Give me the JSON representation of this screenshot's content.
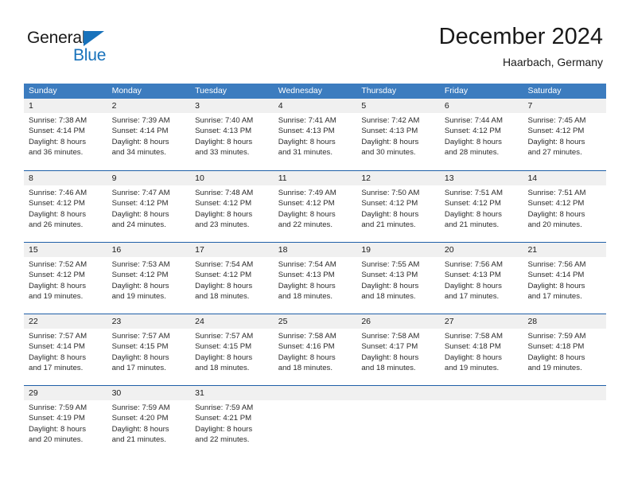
{
  "brand": {
    "name_part1": "General",
    "name_part2": "Blue",
    "logo_icon": "triangle-icon",
    "color_blue": "#1872bb"
  },
  "header": {
    "title": "December 2024",
    "subtitle": "Haarbach, Germany"
  },
  "colors": {
    "header_blue": "#3c7cbf",
    "row_separator_blue": "#1f5fa8",
    "row_band_gray": "#f0f0f0"
  },
  "weekdays": [
    "Sunday",
    "Monday",
    "Tuesday",
    "Wednesday",
    "Thursday",
    "Friday",
    "Saturday"
  ],
  "weeks": [
    [
      {
        "day": "1",
        "sunrise": "Sunrise: 7:38 AM",
        "sunset": "Sunset: 4:14 PM",
        "daylight1": "Daylight: 8 hours",
        "daylight2": "and 36 minutes."
      },
      {
        "day": "2",
        "sunrise": "Sunrise: 7:39 AM",
        "sunset": "Sunset: 4:14 PM",
        "daylight1": "Daylight: 8 hours",
        "daylight2": "and 34 minutes."
      },
      {
        "day": "3",
        "sunrise": "Sunrise: 7:40 AM",
        "sunset": "Sunset: 4:13 PM",
        "daylight1": "Daylight: 8 hours",
        "daylight2": "and 33 minutes."
      },
      {
        "day": "4",
        "sunrise": "Sunrise: 7:41 AM",
        "sunset": "Sunset: 4:13 PM",
        "daylight1": "Daylight: 8 hours",
        "daylight2": "and 31 minutes."
      },
      {
        "day": "5",
        "sunrise": "Sunrise: 7:42 AM",
        "sunset": "Sunset: 4:13 PM",
        "daylight1": "Daylight: 8 hours",
        "daylight2": "and 30 minutes."
      },
      {
        "day": "6",
        "sunrise": "Sunrise: 7:44 AM",
        "sunset": "Sunset: 4:12 PM",
        "daylight1": "Daylight: 8 hours",
        "daylight2": "and 28 minutes."
      },
      {
        "day": "7",
        "sunrise": "Sunrise: 7:45 AM",
        "sunset": "Sunset: 4:12 PM",
        "daylight1": "Daylight: 8 hours",
        "daylight2": "and 27 minutes."
      }
    ],
    [
      {
        "day": "8",
        "sunrise": "Sunrise: 7:46 AM",
        "sunset": "Sunset: 4:12 PM",
        "daylight1": "Daylight: 8 hours",
        "daylight2": "and 26 minutes."
      },
      {
        "day": "9",
        "sunrise": "Sunrise: 7:47 AM",
        "sunset": "Sunset: 4:12 PM",
        "daylight1": "Daylight: 8 hours",
        "daylight2": "and 24 minutes."
      },
      {
        "day": "10",
        "sunrise": "Sunrise: 7:48 AM",
        "sunset": "Sunset: 4:12 PM",
        "daylight1": "Daylight: 8 hours",
        "daylight2": "and 23 minutes."
      },
      {
        "day": "11",
        "sunrise": "Sunrise: 7:49 AM",
        "sunset": "Sunset: 4:12 PM",
        "daylight1": "Daylight: 8 hours",
        "daylight2": "and 22 minutes."
      },
      {
        "day": "12",
        "sunrise": "Sunrise: 7:50 AM",
        "sunset": "Sunset: 4:12 PM",
        "daylight1": "Daylight: 8 hours",
        "daylight2": "and 21 minutes."
      },
      {
        "day": "13",
        "sunrise": "Sunrise: 7:51 AM",
        "sunset": "Sunset: 4:12 PM",
        "daylight1": "Daylight: 8 hours",
        "daylight2": "and 21 minutes."
      },
      {
        "day": "14",
        "sunrise": "Sunrise: 7:51 AM",
        "sunset": "Sunset: 4:12 PM",
        "daylight1": "Daylight: 8 hours",
        "daylight2": "and 20 minutes."
      }
    ],
    [
      {
        "day": "15",
        "sunrise": "Sunrise: 7:52 AM",
        "sunset": "Sunset: 4:12 PM",
        "daylight1": "Daylight: 8 hours",
        "daylight2": "and 19 minutes."
      },
      {
        "day": "16",
        "sunrise": "Sunrise: 7:53 AM",
        "sunset": "Sunset: 4:12 PM",
        "daylight1": "Daylight: 8 hours",
        "daylight2": "and 19 minutes."
      },
      {
        "day": "17",
        "sunrise": "Sunrise: 7:54 AM",
        "sunset": "Sunset: 4:12 PM",
        "daylight1": "Daylight: 8 hours",
        "daylight2": "and 18 minutes."
      },
      {
        "day": "18",
        "sunrise": "Sunrise: 7:54 AM",
        "sunset": "Sunset: 4:13 PM",
        "daylight1": "Daylight: 8 hours",
        "daylight2": "and 18 minutes."
      },
      {
        "day": "19",
        "sunrise": "Sunrise: 7:55 AM",
        "sunset": "Sunset: 4:13 PM",
        "daylight1": "Daylight: 8 hours",
        "daylight2": "and 18 minutes."
      },
      {
        "day": "20",
        "sunrise": "Sunrise: 7:56 AM",
        "sunset": "Sunset: 4:13 PM",
        "daylight1": "Daylight: 8 hours",
        "daylight2": "and 17 minutes."
      },
      {
        "day": "21",
        "sunrise": "Sunrise: 7:56 AM",
        "sunset": "Sunset: 4:14 PM",
        "daylight1": "Daylight: 8 hours",
        "daylight2": "and 17 minutes."
      }
    ],
    [
      {
        "day": "22",
        "sunrise": "Sunrise: 7:57 AM",
        "sunset": "Sunset: 4:14 PM",
        "daylight1": "Daylight: 8 hours",
        "daylight2": "and 17 minutes."
      },
      {
        "day": "23",
        "sunrise": "Sunrise: 7:57 AM",
        "sunset": "Sunset: 4:15 PM",
        "daylight1": "Daylight: 8 hours",
        "daylight2": "and 17 minutes."
      },
      {
        "day": "24",
        "sunrise": "Sunrise: 7:57 AM",
        "sunset": "Sunset: 4:15 PM",
        "daylight1": "Daylight: 8 hours",
        "daylight2": "and 18 minutes."
      },
      {
        "day": "25",
        "sunrise": "Sunrise: 7:58 AM",
        "sunset": "Sunset: 4:16 PM",
        "daylight1": "Daylight: 8 hours",
        "daylight2": "and 18 minutes."
      },
      {
        "day": "26",
        "sunrise": "Sunrise: 7:58 AM",
        "sunset": "Sunset: 4:17 PM",
        "daylight1": "Daylight: 8 hours",
        "daylight2": "and 18 minutes."
      },
      {
        "day": "27",
        "sunrise": "Sunrise: 7:58 AM",
        "sunset": "Sunset: 4:18 PM",
        "daylight1": "Daylight: 8 hours",
        "daylight2": "and 19 minutes."
      },
      {
        "day": "28",
        "sunrise": "Sunrise: 7:59 AM",
        "sunset": "Sunset: 4:18 PM",
        "daylight1": "Daylight: 8 hours",
        "daylight2": "and 19 minutes."
      }
    ],
    [
      {
        "day": "29",
        "sunrise": "Sunrise: 7:59 AM",
        "sunset": "Sunset: 4:19 PM",
        "daylight1": "Daylight: 8 hours",
        "daylight2": "and 20 minutes."
      },
      {
        "day": "30",
        "sunrise": "Sunrise: 7:59 AM",
        "sunset": "Sunset: 4:20 PM",
        "daylight1": "Daylight: 8 hours",
        "daylight2": "and 21 minutes."
      },
      {
        "day": "31",
        "sunrise": "Sunrise: 7:59 AM",
        "sunset": "Sunset: 4:21 PM",
        "daylight1": "Daylight: 8 hours",
        "daylight2": "and 22 minutes."
      },
      {
        "day": "",
        "sunrise": "",
        "sunset": "",
        "daylight1": "",
        "daylight2": ""
      },
      {
        "day": "",
        "sunrise": "",
        "sunset": "",
        "daylight1": "",
        "daylight2": ""
      },
      {
        "day": "",
        "sunrise": "",
        "sunset": "",
        "daylight1": "",
        "daylight2": ""
      },
      {
        "day": "",
        "sunrise": "",
        "sunset": "",
        "daylight1": "",
        "daylight2": ""
      }
    ]
  ]
}
